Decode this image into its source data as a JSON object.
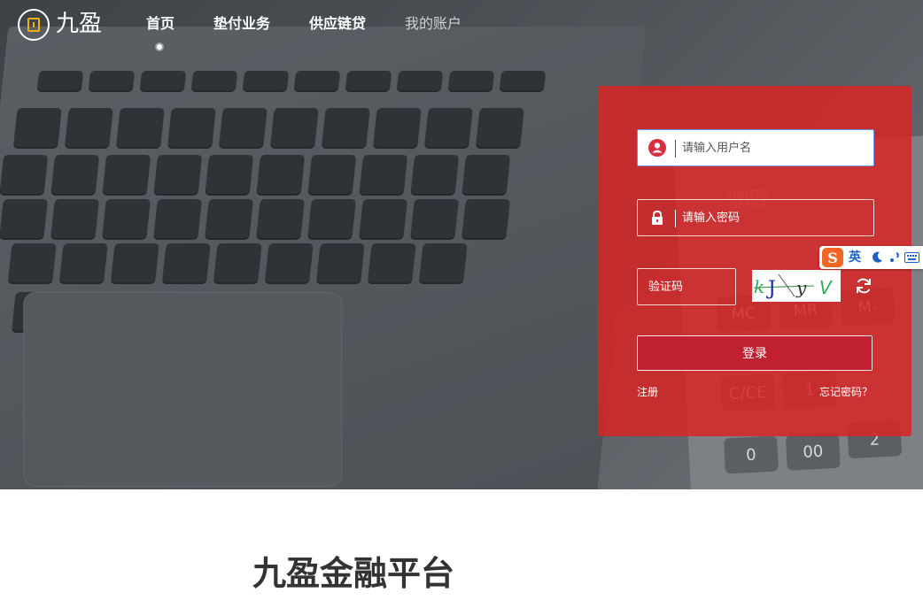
{
  "logo": {
    "text": "九盈"
  },
  "nav": {
    "items": [
      {
        "label": "首页",
        "active": true
      },
      {
        "label": "垫付业务",
        "active": false
      },
      {
        "label": "供应链贷",
        "active": false
      },
      {
        "label": "我的账户",
        "active": false
      }
    ]
  },
  "login": {
    "username_placeholder": "请输入用户名",
    "password_placeholder": "请输入密码",
    "captcha_placeholder": "验证码",
    "captcha_text": "kJyV",
    "submit_label": "登录",
    "register_label": "注册",
    "forgot_label": "忘记密码？",
    "panel_color": "#d62525"
  },
  "ime": {
    "icon": "S",
    "lang_label": "英"
  },
  "main": {
    "title": "九盈金融平台"
  }
}
